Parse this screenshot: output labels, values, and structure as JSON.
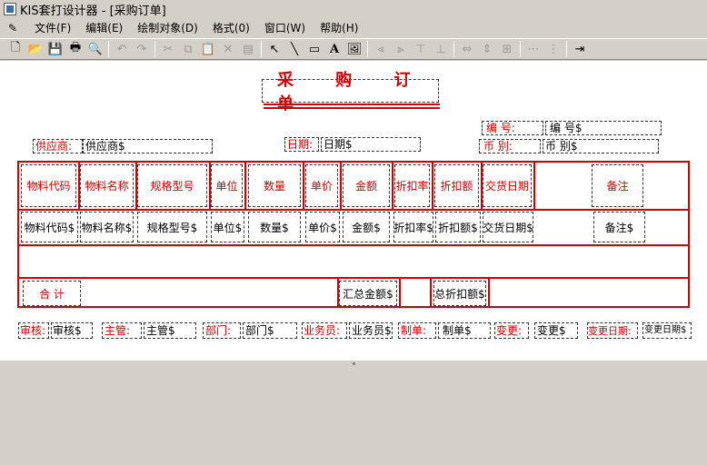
{
  "window": {
    "title": "KIS套打设计器 - [采购订单]"
  },
  "menu": [
    "文件(F)",
    "编辑(E)",
    "绘制对象(D)",
    "格式(0)",
    "窗口(W)",
    "帮助(H)"
  ],
  "form": {
    "title": "采 购 订 单",
    "supplier_label": "供应商:",
    "supplier_value": "供应商$",
    "date_label": "日期:",
    "date_value": "日期$",
    "number_label": "编 号:",
    "number_value": "编 号$",
    "currency_label": "币 别:",
    "currency_value": "币 别$"
  },
  "table": {
    "headers": [
      "物料代码",
      "物料名称",
      "规格型号",
      "单位",
      "数量",
      "单价",
      "金额",
      "折扣率",
      "折扣额",
      "交货日期",
      "",
      "备注"
    ],
    "row": [
      "物料代码$",
      "物料名称$",
      "规格型号$",
      "单位$",
      "数量$",
      "单价$",
      "金额$",
      "折扣率$",
      "折扣额$",
      "交货日期$",
      "",
      "备注$"
    ],
    "total_label": "合 计",
    "total_amount": "汇总金额$",
    "total_discount": "总折扣额$"
  },
  "footer": [
    {
      "label": "审核:",
      "value": "审核$"
    },
    {
      "label": "主管:",
      "value": "主管$"
    },
    {
      "label": "部门:",
      "value": "部门$"
    },
    {
      "label": "业务员:",
      "value": "业务员$"
    },
    {
      "label": "制单:",
      "value": "制单$"
    },
    {
      "label": "变更:",
      "value": "变更$"
    },
    {
      "label": "变更日期:",
      "value": "变更日期$"
    }
  ],
  "colors": {
    "accent": "#d00000",
    "chrome": "#d4d0c8",
    "canvas": "#ffffff"
  }
}
